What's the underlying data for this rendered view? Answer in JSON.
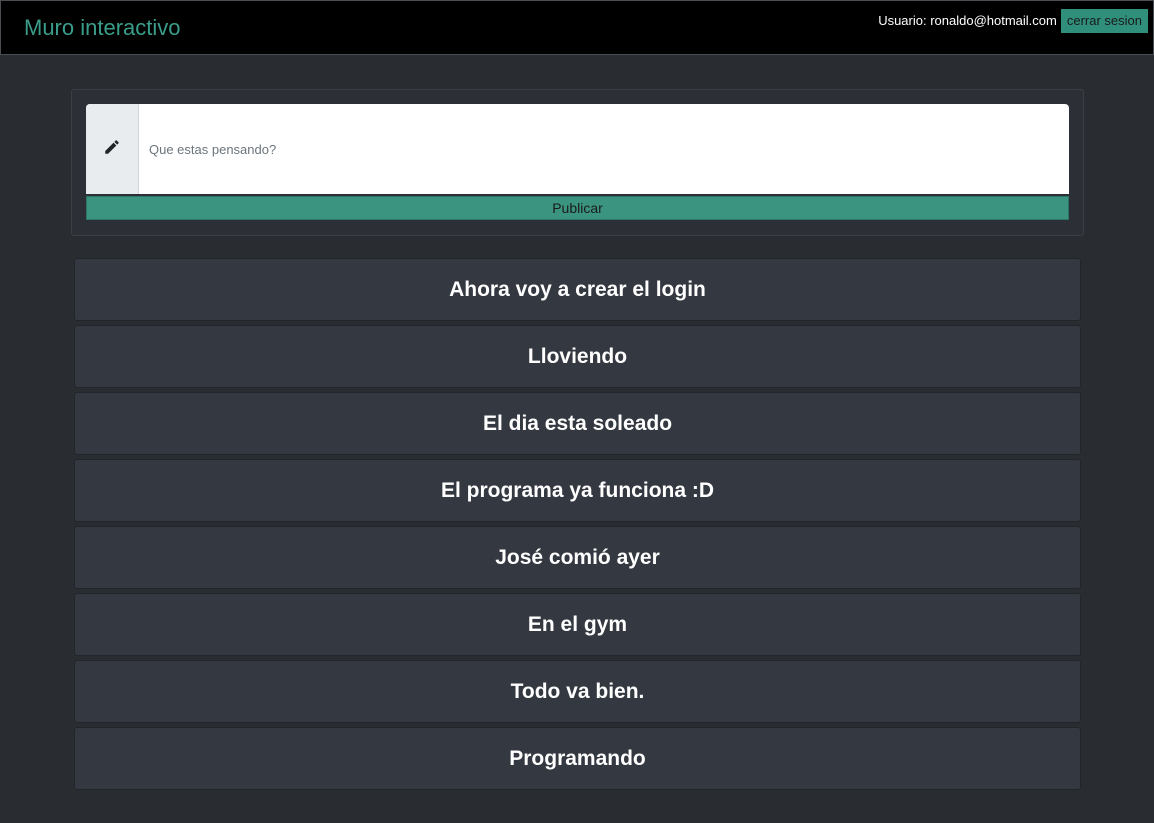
{
  "navbar": {
    "brand": "Muro interactivo",
    "user_text": "Usuario: ronaldo@hotmail.com",
    "logout_label": "cerrar sesion"
  },
  "composer": {
    "icon": "pencil-icon",
    "placeholder": "Que estas pensando?",
    "value": "",
    "publish_label": "Publicar"
  },
  "posts": [
    {
      "text": "Ahora voy a crear el login"
    },
    {
      "text": "Lloviendo"
    },
    {
      "text": "El dia esta soleado"
    },
    {
      "text": "El programa ya funciona :D"
    },
    {
      "text": "José comió ayer"
    },
    {
      "text": "En el gym"
    },
    {
      "text": "Todo va bien."
    },
    {
      "text": "Programando"
    }
  ],
  "colors": {
    "accent": "#3a9480",
    "brand": "#3a9d8a",
    "background": "#292c31",
    "card": "#343840",
    "navbar": "#000000"
  }
}
